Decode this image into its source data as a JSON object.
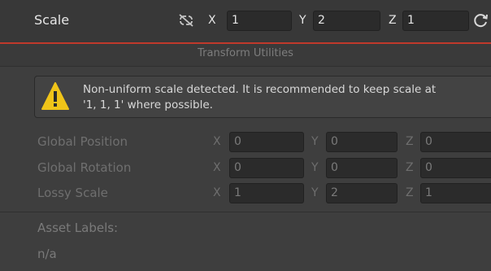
{
  "scale_row": {
    "label": "Scale",
    "x_label": "X",
    "x_value": "1",
    "y_label": "Y",
    "y_value": "2",
    "z_label": "Z",
    "z_value": "1"
  },
  "utilities_header": "Transform Utilities",
  "warning": {
    "line1": "Non-uniform scale detected. It is recommended to keep scale at",
    "line2": "'1, 1, 1' where possible."
  },
  "rows": [
    {
      "label": "Global Position",
      "x": "0",
      "y": "0",
      "z": "0"
    },
    {
      "label": "Global Rotation",
      "x": "0",
      "y": "0",
      "z": "0"
    },
    {
      "label": "Lossy Scale",
      "x": "1",
      "y": "2",
      "z": "1"
    }
  ],
  "axis_labels": {
    "x": "X",
    "y": "Y",
    "z": "Z"
  },
  "asset_labels": {
    "title": "Asset Labels:",
    "value": "n/a"
  },
  "colors": {
    "background": "#3e3e3e",
    "header_bg": "#383838",
    "accent_red": "#c0392b",
    "warning_yellow": "#f0c419"
  }
}
